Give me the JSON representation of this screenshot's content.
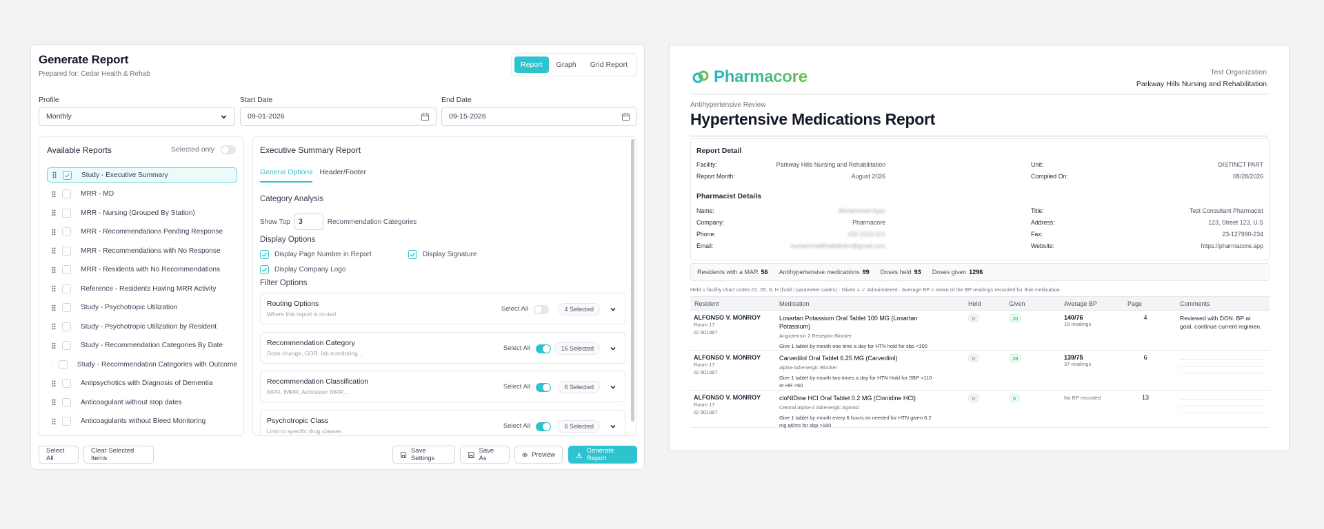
{
  "form": {
    "title": "Generate Report",
    "subtitle": "Prepared for: Cedar Health & Rehab",
    "view_tabs": [
      "Report",
      "Graph",
      "Grid Report"
    ],
    "active_view": "Report",
    "profile_label": "Profile",
    "profile_value": "Monthly",
    "start_label": "Start Date",
    "start_value": "09-01-2026",
    "end_label": "End Date",
    "end_value": "09-15-2026"
  },
  "available": {
    "title": "Available Reports",
    "selected_only_label": "Selected only",
    "items": [
      {
        "label": "Study - Executive Summary",
        "checked": true
      },
      {
        "label": "MRR - MD",
        "checked": false
      },
      {
        "label": "MRR - Nursing (Grouped By Station)",
        "checked": false
      },
      {
        "label": "MRR - Recommendations Pending Response",
        "checked": false
      },
      {
        "label": "MRR - Recommendations with No Response",
        "checked": false
      },
      {
        "label": "MRR - Residents with No Recommendations",
        "checked": false
      },
      {
        "label": "Reference - Residents Having MRR Activity",
        "checked": false
      },
      {
        "label": "Study - Psychotropic Utilization",
        "checked": false
      },
      {
        "label": "Study - Psychotropic Utilization by Resident",
        "checked": false
      },
      {
        "label": "Study - Recommendation Categories By Date",
        "checked": false
      },
      {
        "label": "Study - Recommendation Categories with Outcome",
        "checked": false
      },
      {
        "label": "Antipsychotics with Diagnosis of Dementia",
        "checked": false
      },
      {
        "label": "Anticoagulant without stop dates",
        "checked": false
      },
      {
        "label": "Anticoagulants without Bleed Monitoring",
        "checked": false
      }
    ]
  },
  "exec": {
    "title": "Executive Summary Report",
    "tabs": [
      "General Options",
      "Header/Footer"
    ],
    "category_analysis": "Category Analysis",
    "show_top_label": "Show Top",
    "show_top_value": "3",
    "show_top_suffix": "Recommendation Categories",
    "display_options": "Display Options",
    "opt_page_number": "Display Page Number in Report",
    "opt_signature": "Display Signature",
    "opt_company_logo": "Display Company Logo",
    "filter_options": "Filter Options",
    "select_all": "Select All",
    "filters": [
      {
        "title": "Routing Options",
        "sub": "Where this report is routed",
        "badge": "4 Selected",
        "on": false
      },
      {
        "title": "Recommendation Category",
        "sub": "Dose change, GDR, lab monitoring...",
        "badge": "16 Selected",
        "on": true
      },
      {
        "title": "Recommendation Classification",
        "sub": "MRR, IMRR, Admission MRR...",
        "badge": "6 Selected",
        "on": true
      },
      {
        "title": "Psychotropic Class",
        "sub": "Limit to specific drug classes",
        "badge": "6 Selected",
        "on": true
      }
    ]
  },
  "buttons": {
    "select_all": "Select All",
    "clear": "Clear Selected Items",
    "save_settings": "Save Settings",
    "save_as": "Save As",
    "preview": "Preview",
    "generate": "Generate Report"
  },
  "report": {
    "brand": "Pharmacore",
    "org": "Test Organization",
    "facility_header": "Parkway Hills Nursing and Rehabilitation",
    "kicker": "Antihypertensive Review",
    "title": "Hypertensive Medications Report",
    "detail_title": "Report Detail",
    "facility_label": "Facility:",
    "facility_value": "Parkway Hills Nursing and Rehabilitation",
    "unit_label": "Unit:",
    "unit_value": "DISTINCT PART",
    "month_label": "Report Month:",
    "month_value": "August 2026",
    "compiled_label": "Compiled On:",
    "compiled_value": "08/28/2026",
    "pharm_title": "Pharmacist Details",
    "name_label": "Name:",
    "name_value": "Muhammad Ayaz",
    "ptitle_label": "Title:",
    "ptitle_value": "Test Consultant Pharmacist",
    "company_label": "Company:",
    "company_value": "Pharmacore",
    "address_label": "Address:",
    "address_value": "123, Street 123, U.S",
    "phone_label": "Phone:",
    "phone_value": "432-2123-101",
    "fax_label": "Fax:",
    "fax_value": "23-127990-234",
    "email_label": "Email:",
    "email_value": "muhammadkhattakdev@gmail.com",
    "website_label": "Website:",
    "website_value": "https://pharmacore.app",
    "stats": [
      {
        "label": "Residents with a MAR",
        "value": "56"
      },
      {
        "label": "Antihypertensive medications",
        "value": "99"
      },
      {
        "label": "Doses held",
        "value": "93"
      },
      {
        "label": "Doses given",
        "value": "1296"
      }
    ],
    "legend": "Held = facility chart codes 01, 05, 6, H (hold / parameter codes) · Given = ✓ Administered · Average BP = mean of the BP readings recorded for that medication",
    "columns": [
      "Resident",
      "Medication",
      "Held",
      "Given",
      "Average BP",
      "Page",
      "Comments"
    ],
    "rows": [
      {
        "resident": "ALFONSO V. MONROY",
        "room": "Room 17",
        "id": "ID 901387",
        "med": "Losartan Potassium Oral Tablet 100 MG (Losartan Potassium)",
        "cls": "Angiotensin 2 Receptor Blocker",
        "sig": "Give 1 tablet by mouth one time a day for HTN hold for sbp <100",
        "held": "0",
        "given": "20",
        "bp": "140/76",
        "readings": "19 readings",
        "page": "4",
        "comment": "Reviewed with DON. BP at goal, continue current regimen."
      },
      {
        "resident": "ALFONSO V. MONROY",
        "room": "Room 17",
        "id": "ID 901387",
        "med": "Carvedilol Oral Tablet 6.25 MG (Carvedilol)",
        "cls": "alpha-Adrenergic Blocker",
        "sig": "Give 1 tablet by mouth two times a day for HTN Hold for SBP <110 or HR <60",
        "held": "0",
        "given": "28",
        "bp": "139/75",
        "readings": "37 readings",
        "page": "6",
        "comment": ""
      },
      {
        "resident": "ALFONSO V. MONROY",
        "room": "Room 17",
        "id": "ID 901387",
        "med": "cloNIDine HCl Oral Tablet 0.2 MG (Clonidine HCl)",
        "cls": "Central alpha-2 Adrenergic Agonist",
        "sig": "Give 1 tablet by mouth every 6 hours as needed for HTN given 0.2 mg q6hrs for sbp >160",
        "held": "0",
        "given": "0",
        "bp": "",
        "readings": "",
        "no_bp": "No BP recorded",
        "page": "13",
        "comment": ""
      }
    ]
  },
  "colors": {
    "accent": "#2ec4cf",
    "brand_green": "#6cc04a"
  }
}
